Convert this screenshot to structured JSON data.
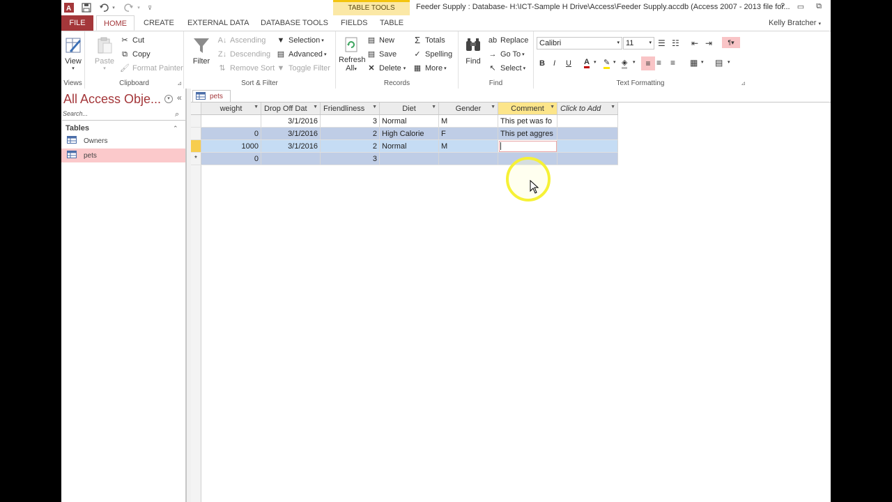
{
  "titlebar": {
    "contextual_group": "TABLE TOOLS",
    "document_title": "Feeder Supply : Database- H:\\ICT-Sample H Drive\\Access\\Feeder Supply.accdb (Access 2007 - 2013 file for..."
  },
  "tabs": {
    "file": "FILE",
    "home": "HOME",
    "create": "CREATE",
    "external": "EXTERNAL DATA",
    "dbtools": "DATABASE TOOLS",
    "fields": "FIELDS",
    "table": "TABLE"
  },
  "user": "Kelly Bratcher",
  "ribbon": {
    "views": {
      "view": "View",
      "label": "Views"
    },
    "clipboard": {
      "paste": "Paste",
      "cut": "Cut",
      "copy": "Copy",
      "format_painter": "Format Painter",
      "label": "Clipboard"
    },
    "sort_filter": {
      "filter": "Filter",
      "ascending": "Ascending",
      "descending": "Descending",
      "remove_sort": "Remove Sort",
      "selection": "Selection",
      "advanced": "Advanced",
      "toggle_filter": "Toggle Filter",
      "label": "Sort & Filter"
    },
    "records": {
      "refresh": "Refresh",
      "refresh_all": "All",
      "new": "New",
      "save": "Save",
      "delete": "Delete",
      "totals": "Totals",
      "spelling": "Spelling",
      "more": "More",
      "label": "Records"
    },
    "find": {
      "find": "Find",
      "replace": "Replace",
      "goto": "Go To",
      "select": "Select",
      "label": "Find"
    },
    "text_formatting": {
      "font": "Calibri",
      "size": "11",
      "bold": "B",
      "italic": "I",
      "underline": "U",
      "label": "Text Formatting"
    }
  },
  "nav": {
    "title": "All Access Obje...",
    "search_placeholder": "Search...",
    "section": "Tables",
    "items": [
      {
        "label": "Owners"
      },
      {
        "label": "pets"
      }
    ]
  },
  "doc_tab": "pets",
  "grid": {
    "columns": [
      "weight",
      "Drop Off Dat",
      "Friendliness",
      "Diet",
      "Gender",
      "Comment",
      "Click to Add"
    ],
    "rows": [
      {
        "weight": "",
        "drop_off": "3/1/2016",
        "friendliness": "3",
        "diet": "Normal",
        "gender": "M",
        "comment": "This pet was fo"
      },
      {
        "weight": "0",
        "drop_off": "3/1/2016",
        "friendliness": "2",
        "diet": "High Calorie",
        "gender": "F",
        "comment": "This pet aggres"
      },
      {
        "weight": "1000",
        "drop_off": "3/1/2016",
        "friendliness": "2",
        "diet": "Normal",
        "gender": "M",
        "comment": ""
      }
    ],
    "new_row": {
      "marker": "*",
      "weight": "0",
      "friendliness": "3"
    }
  },
  "colors": {
    "accent": "#a4373a",
    "selected_col": "#fce58a",
    "alt_row": "#bfcde6",
    "current_row": "#c5dcf4"
  }
}
